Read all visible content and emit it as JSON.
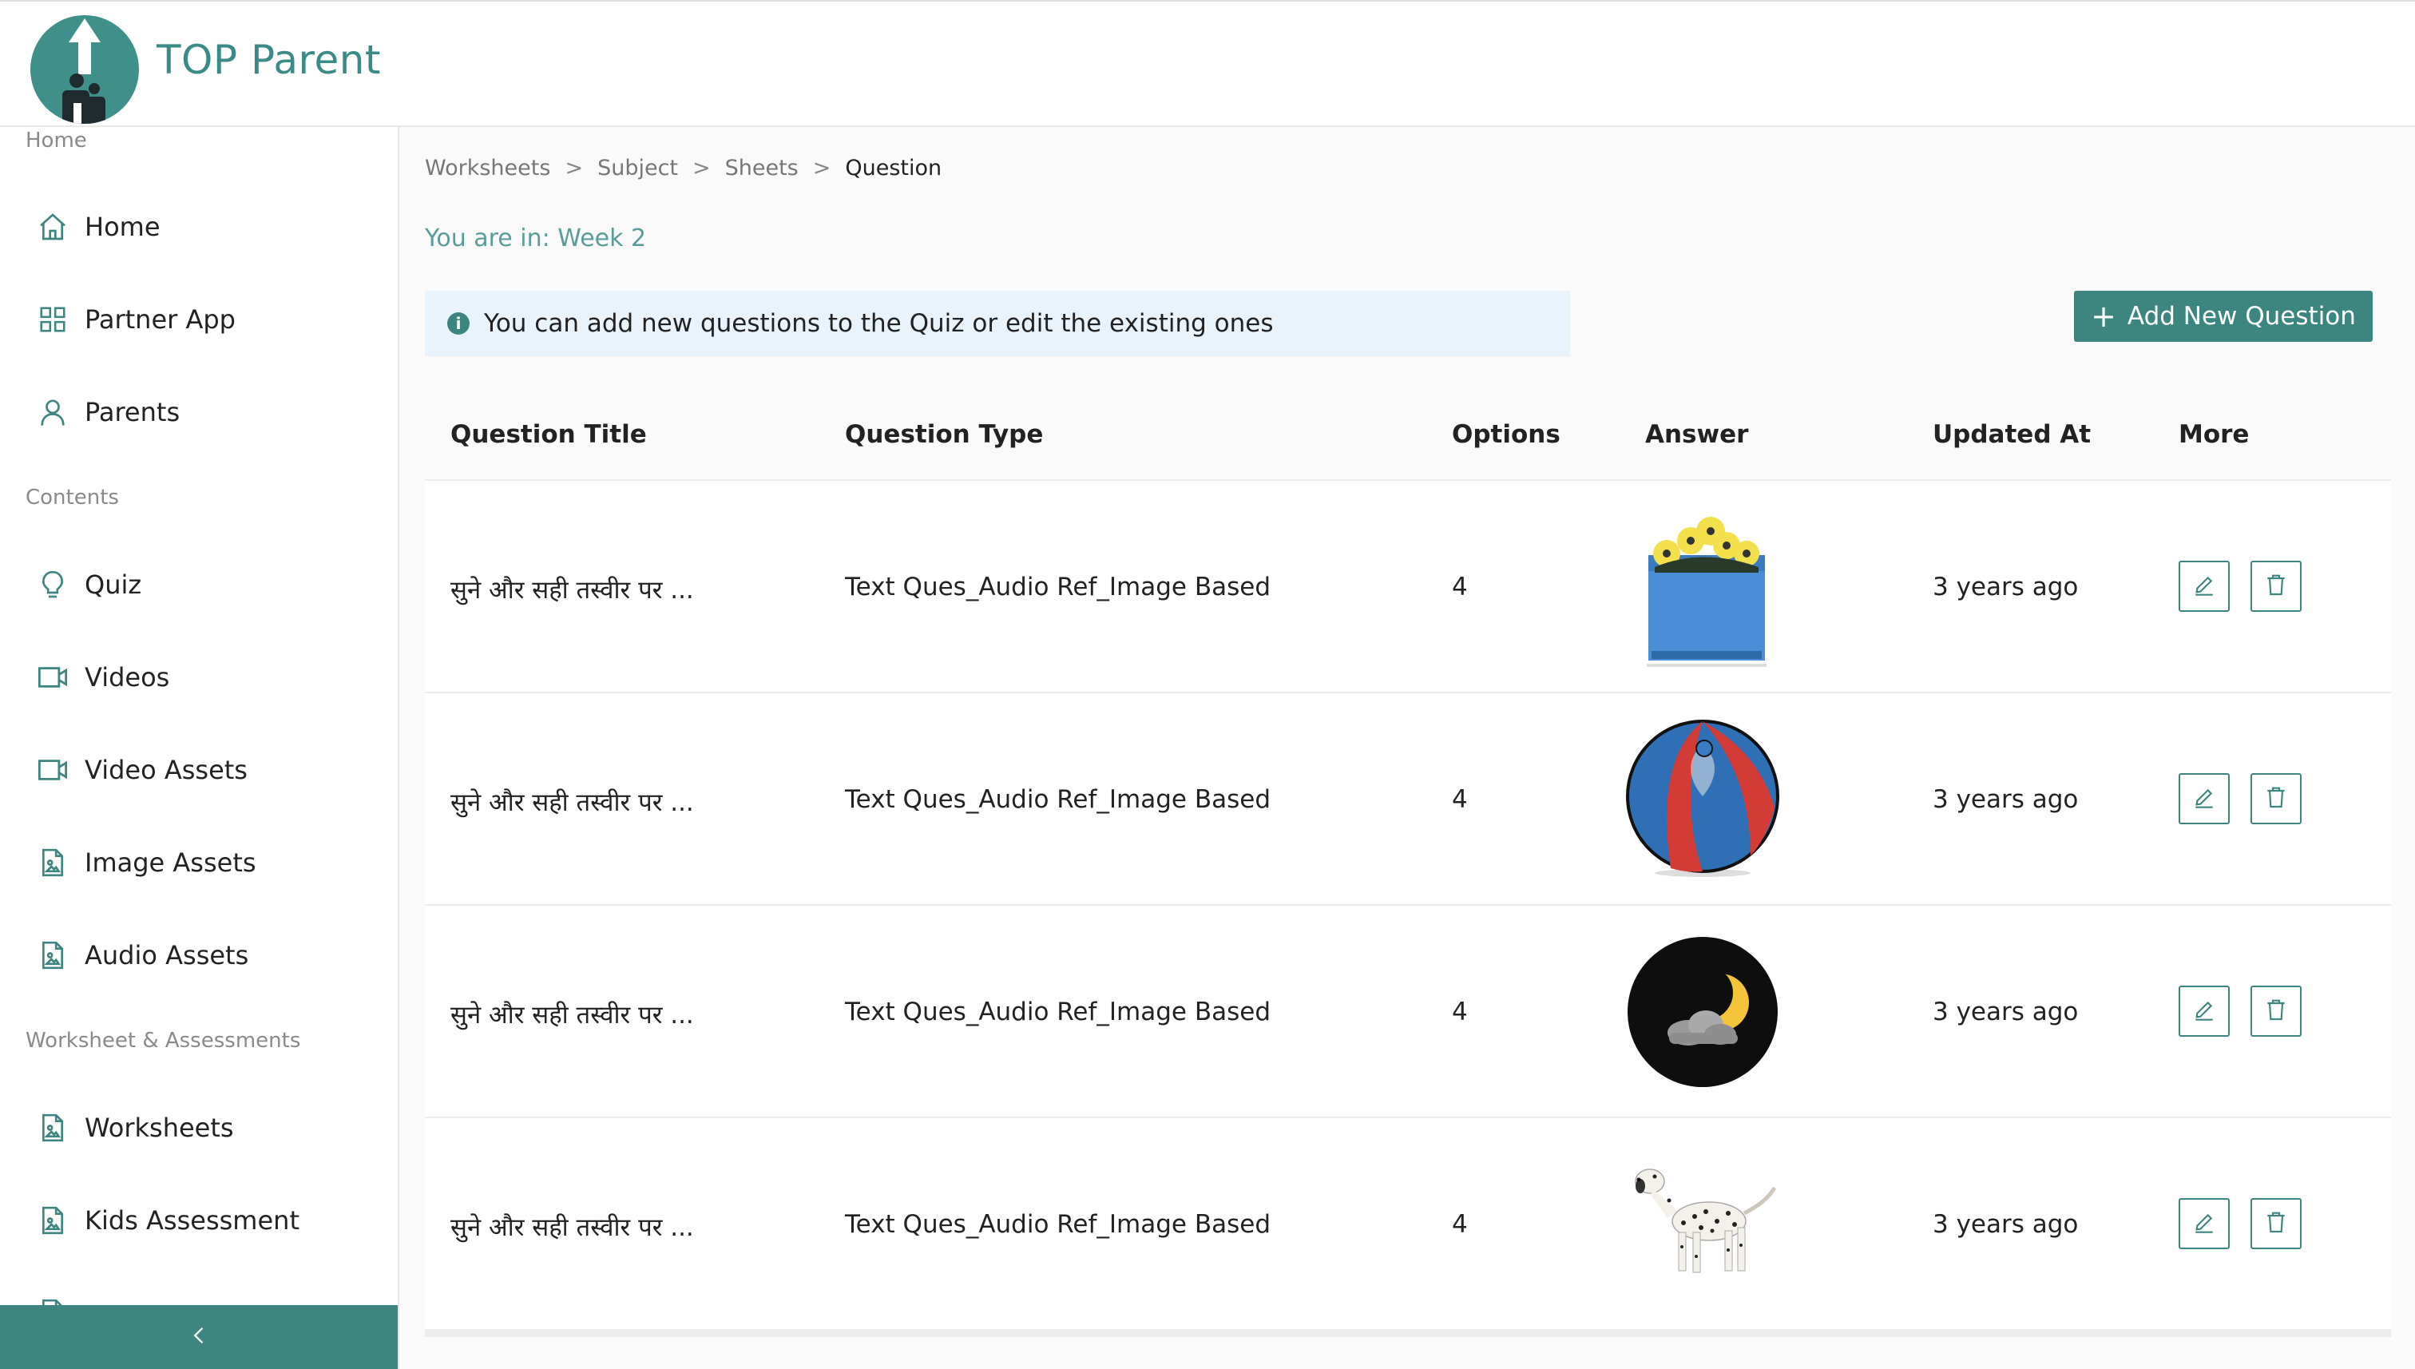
{
  "app": {
    "brand": "TOP Parent",
    "accent": "#3d8581"
  },
  "sidebar": {
    "top_label": "Home",
    "sections": [
      {
        "label": "Home",
        "items": [
          {
            "label": "Home",
            "icon": "home-icon"
          },
          {
            "label": "Partner App",
            "icon": "grid-icon"
          },
          {
            "label": "Parents",
            "icon": "user-icon"
          }
        ]
      },
      {
        "label": "Contents",
        "items": [
          {
            "label": "Quiz",
            "icon": "lightbulb-icon"
          },
          {
            "label": "Videos",
            "icon": "video-icon"
          },
          {
            "label": "Video Assets",
            "icon": "video-icon"
          },
          {
            "label": "Image Assets",
            "icon": "image-file-icon"
          },
          {
            "label": "Audio Assets",
            "icon": "image-file-icon"
          }
        ]
      },
      {
        "label": "Worksheet & Assessments",
        "items": [
          {
            "label": "Worksheets",
            "icon": "image-file-icon"
          },
          {
            "label": "Kids Assessment",
            "icon": "image-file-icon"
          }
        ]
      }
    ],
    "collapse_icon": "chevron-left-icon"
  },
  "breadcrumb": {
    "items": [
      "Worksheets",
      "Subject",
      "Sheets",
      "Question"
    ],
    "separator": ">"
  },
  "location": "You are in: Week 2",
  "info_message": "You can add new questions to the Quiz or edit the existing ones",
  "add_button": {
    "label": "Add New Question",
    "icon": "plus-icon"
  },
  "table": {
    "headers": [
      "Question Title",
      "Question Type",
      "Options",
      "Answer",
      "Updated At",
      "More"
    ],
    "rows": [
      {
        "title": "सुने और सही तस्वीर पर ...",
        "type": "Text Ques_Audio Ref_Image Based",
        "options": "4",
        "answer_image": "flower-pot-image",
        "updated": "3 years ago"
      },
      {
        "title": "सुने और सही तस्वीर पर ...",
        "type": "Text Ques_Audio Ref_Image Based",
        "options": "4",
        "answer_image": "beach-ball-image",
        "updated": "3 years ago"
      },
      {
        "title": "सुने और सही तस्वीर पर ...",
        "type": "Text Ques_Audio Ref_Image Based",
        "options": "4",
        "answer_image": "moon-cloud-night-image",
        "updated": "3 years ago"
      },
      {
        "title": "सुने और सही तस्वीर पर ...",
        "type": "Text Ques_Audio Ref_Image Based",
        "options": "4",
        "answer_image": "dalmatian-dog-image",
        "updated": "3 years ago"
      }
    ]
  }
}
